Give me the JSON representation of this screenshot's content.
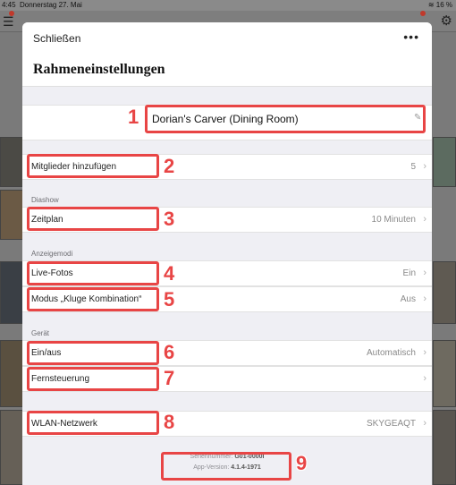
{
  "status_bar": {
    "time": "4:45",
    "date": "Donnerstag 27. Mai",
    "battery": "16 %"
  },
  "icons": {
    "menu": "menu-icon",
    "gear": "gear-icon",
    "wifi": "wifi-icon",
    "chevron": "chevron-right-icon",
    "edit": "pencil-icon",
    "more": "more-icon"
  },
  "header": {
    "close_label": "Schließen",
    "more_label": "•••",
    "title": "Rahmeneinstellungen"
  },
  "frame_name": "Dorian's Carver (Dining Room)",
  "rows": [
    {
      "label": "Mitglieder hinzufügen",
      "value": "5"
    },
    {
      "section": "Diashow",
      "label": "Zeitplan",
      "value": "10 Minuten"
    },
    {
      "section": "Anzeigemodi",
      "label": "Live-Fotos",
      "value": "Ein"
    },
    {
      "label": "Modus „Kluge Kombination“",
      "value": "Aus"
    },
    {
      "section": "Gerät",
      "label": "Ein/aus",
      "value": "Automatisch"
    },
    {
      "label": "Fernsteuerung",
      "value": ""
    },
    {
      "label": "WLAN-Netzwerk",
      "value": "SKYGEAQT"
    }
  ],
  "footer": {
    "serial_label": "Seriennummer:",
    "serial_value": "G01-0000I",
    "version_label": "App-Version:",
    "version_value": "4.1.4-1971"
  },
  "annotations": [
    "1",
    "2",
    "3",
    "4",
    "5",
    "6",
    "7",
    "8",
    "9"
  ],
  "colors": {
    "highlight": "#e84545",
    "sheet_bg": "#efeff4",
    "backdrop": "#7a7a7a"
  }
}
